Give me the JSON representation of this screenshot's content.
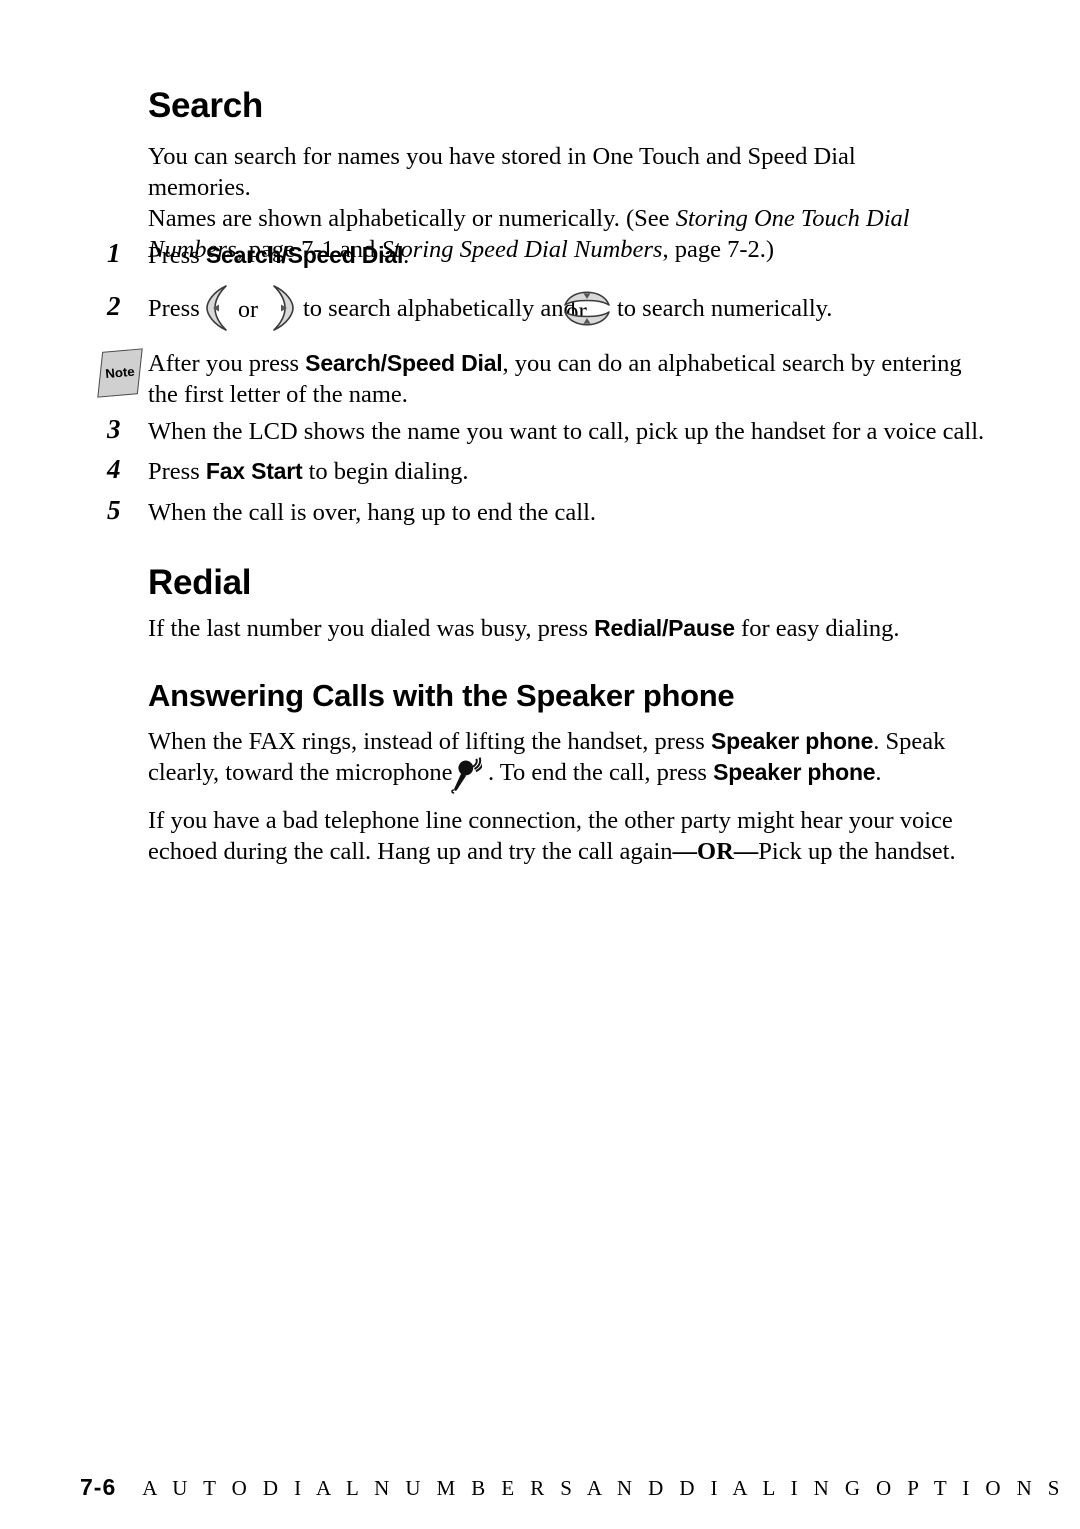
{
  "document": {
    "type": "printed-manual-page",
    "page_label": "7-6",
    "footer_title": "A U T O   D I A L   N U M B E R S   A N D   D I A L I N G   O P T I O N S"
  },
  "sections": {
    "search": {
      "heading": "Search",
      "intro_line1": "You can search for names you have stored in One Touch and Speed Dial memories.",
      "intro_line2_a": "Names are shown alphabetically or numerically. (See ",
      "intro_line2_i": "Storing One Touch Dial",
      "intro_line3_i1": "Numbers",
      "intro_line3_a": ", page 7-1 and ",
      "intro_line3_i2": "Storing Speed Dial Numbers",
      "intro_line3_b": ", page 7-2.)",
      "steps": [
        {
          "number": "1",
          "pre": "Press ",
          "bold": "Search/Speed Dial",
          "post": "."
        },
        {
          "number": "2",
          "pre": "Press ",
          "mid_or": "or",
          "mid": " to search alphabetically and ",
          "post": " to search numerically."
        },
        {
          "number": "3",
          "pre": "When the LCD shows the name you want to call, pick up the handset for a voice call.",
          "bold": "",
          "post": ""
        },
        {
          "number": "4",
          "pre": "Press ",
          "bold": "Fax Start",
          "post": " to begin dialing."
        },
        {
          "number": "5",
          "pre": "When the call is over, hang up to end the call.",
          "bold": "",
          "post": ""
        }
      ],
      "note": {
        "badge_label": "Note",
        "line1_a": "After you press ",
        "line1_bold": "Search/Speed Dial",
        "line1_b": ", you can do an alphabetical search by entering",
        "line2": "the first letter of the name."
      }
    },
    "redial": {
      "heading": "Redial",
      "body_a": "If the last number you dialed was busy, press ",
      "body_bold": "Redial/Pause",
      "body_b": " for easy dialing."
    },
    "speakerphone": {
      "heading": "Answering Calls with the Speaker phone",
      "p1_line1_a": "When the FAX rings, instead of lifting the handset, press ",
      "p1_line1_bold": "Speaker phone",
      "p1_line1_b": ". Speak",
      "p1_line2_a": "clearly, toward the microphone ",
      "p1_line2_b": ". To end the call, press ",
      "p1_line2_bold": "Speaker phone",
      "p1_line2_c": ".",
      "p2_line1": "If you have a bad telephone line connection, the other party might hear your voice",
      "p2_line2_a": "echoed during the call. Hang up and try the call again",
      "p2_line2_bold": "—OR—",
      "p2_line2_b": "Pick up the handset."
    }
  },
  "icons": {
    "left_key": "left-arrow-key-icon",
    "right_key": "right-arrow-key-icon",
    "up_key": "up-arrow-key-icon",
    "down_key": "down-arrow-key-icon",
    "note_badge": "note-icon",
    "microphone": "microphone-icon"
  },
  "colors": {
    "page_background": "#ffffff",
    "text": "#000000",
    "key_fill": "#d9d9d9",
    "key_stroke": "#3a3a3a",
    "note_fill": "#d0d0d0"
  }
}
